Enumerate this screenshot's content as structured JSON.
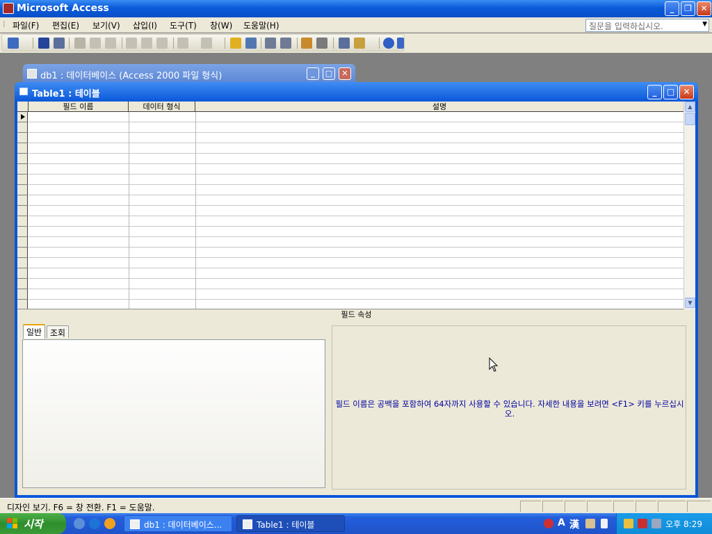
{
  "app": {
    "title": "Microsoft Access"
  },
  "menu": {
    "items": [
      "파일(F)",
      "편집(E)",
      "보기(V)",
      "삽입(I)",
      "도구(T)",
      "창(W)",
      "도움말(H)"
    ],
    "ask_placeholder": "질문을 입력하십시오."
  },
  "toolbar": {
    "icons": [
      "view-icon",
      "save-icon",
      "properties-icon",
      "print-icon",
      "print-preview-icon",
      "spelling-icon",
      "cut-icon",
      "copy-icon",
      "paste-icon",
      "undo-icon",
      "redo-icon",
      "primary-key-icon",
      "build-icon",
      "insert-rows-icon",
      "delete-rows-icon",
      "properties-sheet-icon",
      "indexes-icon",
      "database-window-icon",
      "new-object-icon",
      "help-icon"
    ]
  },
  "db_window": {
    "title": "db1 : 데이터베이스 (Access 2000 파일 형식)"
  },
  "table_window": {
    "title": "Table1 : 테이블",
    "columns": [
      "필드 이름",
      "데이터 형식",
      "설명"
    ],
    "field_properties_label": "필드 속성",
    "tabs": [
      "일반",
      "조회"
    ],
    "help_text": "필드 이름은 공백을 포함하여 64자까지 사용할 수 있습니다. 자세한 내용을 보려면 <F1> 키를 누르십시오."
  },
  "status": {
    "text": "디자인 보기.  F6 = 창 전환.  F1 = 도움말."
  },
  "taskbar": {
    "start_label": "시작",
    "tasks": [
      "db1 : 데이터베이스...",
      "Table1 : 테이블"
    ],
    "ime_mode": "A",
    "ime_hanja": "漢",
    "clock": "오후 8:29"
  },
  "colors": {
    "title_blue": "#0a58d9",
    "face": "#ece9d8",
    "help_text": "#0000a0",
    "start_green": "#3a9a37"
  }
}
